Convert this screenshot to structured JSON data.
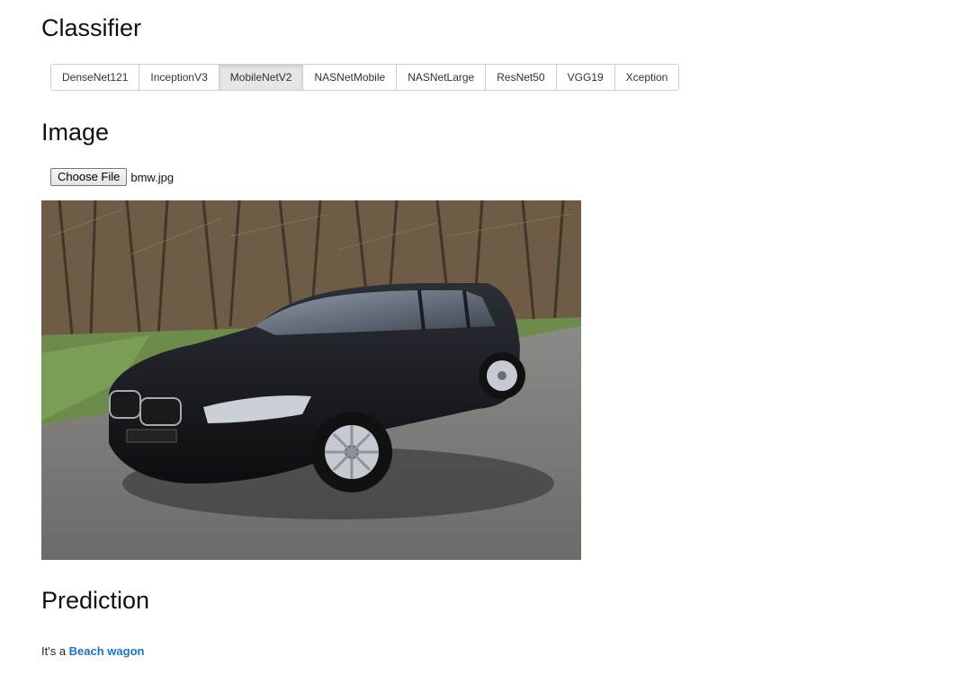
{
  "headings": {
    "classifier": "Classifier",
    "image": "Image",
    "prediction": "Prediction"
  },
  "classifier": {
    "selected": "MobileNetV2",
    "options": [
      "DenseNet121",
      "InceptionV3",
      "MobileNetV2",
      "NASNetMobile",
      "NASNetLarge",
      "ResNet50",
      "VGG19",
      "Xception"
    ]
  },
  "file_input": {
    "button_label": "Choose File",
    "file_name": "bmw.jpg"
  },
  "prediction": {
    "prefix": "It's a ",
    "label": "Beach wagon"
  },
  "colors": {
    "link": "#1a73c9",
    "active_tab_bg": "#e6e6e6"
  }
}
